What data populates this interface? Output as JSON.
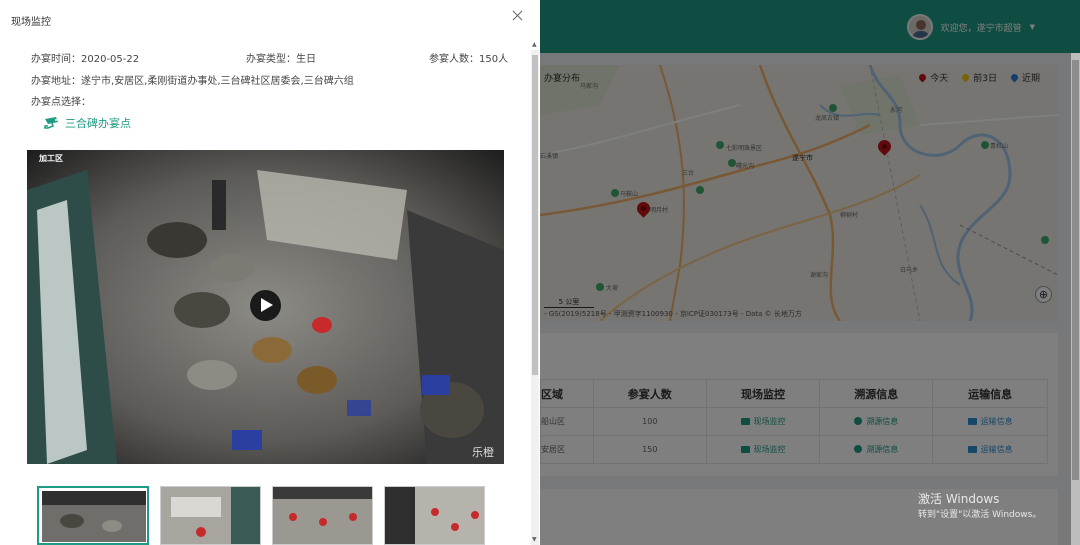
{
  "dashboard": {
    "user_greeting": "欢迎您，遂宁市超管",
    "map": {
      "title": "办宴分布",
      "legend": [
        {
          "label": "今天",
          "color": "#c0151b"
        },
        {
          "label": "前3日",
          "color": "#f0c419"
        },
        {
          "label": "近期",
          "color": "#2a7fd4"
        }
      ],
      "scale": "5 公里",
      "credit": "- GS(2019)5218号 - 甲测资字1100930 - 京ICP证030173号 - Data © 长地万方",
      "place_labels": [
        "马家沟",
        "龙凤古镇",
        "七彩明珠景区",
        "曙光沟",
        "遂宁市",
        "永河",
        "马鞍山",
        "明月村",
        "石溪镇",
        "青杠山",
        "三台",
        "大坡",
        "白马乡",
        "谢家沟",
        "柳树村"
      ]
    },
    "table": {
      "headers": [
        "区域",
        "参宴人数",
        "现场监控",
        "溯源信息",
        "运输信息"
      ],
      "rows": [
        {
          "area": "船山区",
          "people": "100",
          "monitor": "现场监控",
          "trace": "溯源信息",
          "transport": "运输信息"
        },
        {
          "area": "安居区",
          "people": "150",
          "monitor": "现场监控",
          "trace": "溯源信息",
          "transport": "运输信息"
        }
      ]
    },
    "windows_watermark": {
      "title": "激活 Windows",
      "sub": "转到\"设置\"以激活 Windows。"
    }
  },
  "modal": {
    "title": "现场监控",
    "date_label": "办宴时间：2020-05-22",
    "type_label": "办宴类型：生日",
    "people_label": "参宴人数：150人",
    "address_label": "办宴地址：遂宁市,安居区,柔刚街道办事处,三台碑社区居委会,三台碑六组",
    "site_select_label": "办宴点选择：",
    "site_name": "三合碑办宴点",
    "camera_label": "加工区",
    "video_watermark": "乐橙",
    "thumbnails": 4,
    "selected_thumbnail": 0
  }
}
